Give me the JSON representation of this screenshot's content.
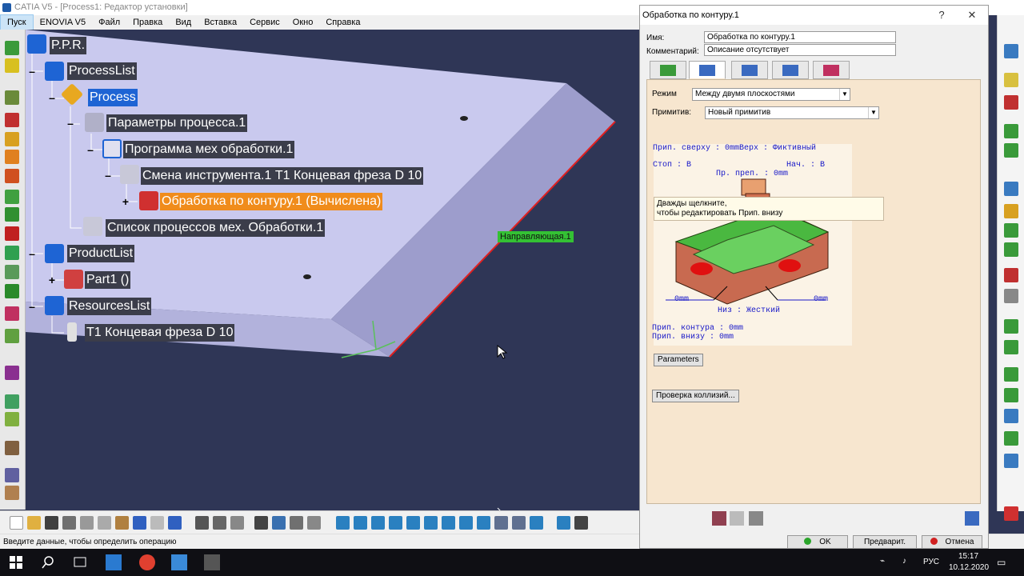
{
  "window": {
    "title": "CATIA V5 - [Process1: Редактор установки]"
  },
  "menu": [
    "Пуск",
    "ENOVIA V5",
    "Файл",
    "Правка",
    "Вид",
    "Вставка",
    "Сервис",
    "Окно",
    "Справка"
  ],
  "tree": {
    "root": "P.P.R.",
    "process_list": "ProcessList",
    "process": "Process",
    "process_params": "Параметры процесса.1",
    "machining_program": "Программа мех обработки.1",
    "tool_change": "Смена инструмента.1  T1 Концевая фреза D 10",
    "contour_op": "Обработка по контуру.1 (Вычислена)",
    "process_list_item": "Список процессов мех. Обработки.1",
    "product_list": "ProductList",
    "part": "Part1 ()",
    "resources_list": "ResourcesList",
    "tool": "T1 Концевая фреза D 10"
  },
  "viewport": {
    "guide_label": "Направляющая.1"
  },
  "dialog": {
    "title": "Обработка по контуру.1",
    "help": "?",
    "close": "✕",
    "name_label": "Имя:",
    "name_value": "Обработка по контуру.1",
    "comment_label": "Комментарий:",
    "comment_value": "Описание отсутствует",
    "mode_label": "Режим",
    "mode_value": "Между двумя плоскостями",
    "primitive_label": "Примитив:",
    "primitive_value": "Новый примитив",
    "tooltip_line1": "Дважды щелкните,",
    "tooltip_line2": "чтобы редактировать Прип. внизу",
    "diagram": {
      "top_allowance": "Прип. сверху : 0mmВерх : Фиктивный",
      "stop": "Стоп : В",
      "start": "Нач. : В",
      "obstacle_allowance": "Пр. преп. : 0mm",
      "left_dim": "0mm",
      "right_dim": "0mm",
      "bottom": "Низ : Жесткий",
      "contour_allowance": "Прип. контура : 0mm",
      "bottom_allowance": "Прип. внизу : 0mm"
    },
    "parameters_button": "Parameters",
    "collision_button": "Проверка коллизий...",
    "ok": "OK",
    "preview": "Предварит.",
    "cancel": "Отмена"
  },
  "status": {
    "message": "Введите данные, чтобы определить операцию"
  },
  "taskbar": {
    "lang": "РУС",
    "time": "15:17",
    "date": "10.12.2020"
  },
  "colors": {
    "viewport_bg": "#2f3656",
    "selection_orange": "#f08c1c",
    "selection_blue": "#1e64d4",
    "panel_bg": "#f7e6cf",
    "edge_red": "#e02020"
  }
}
